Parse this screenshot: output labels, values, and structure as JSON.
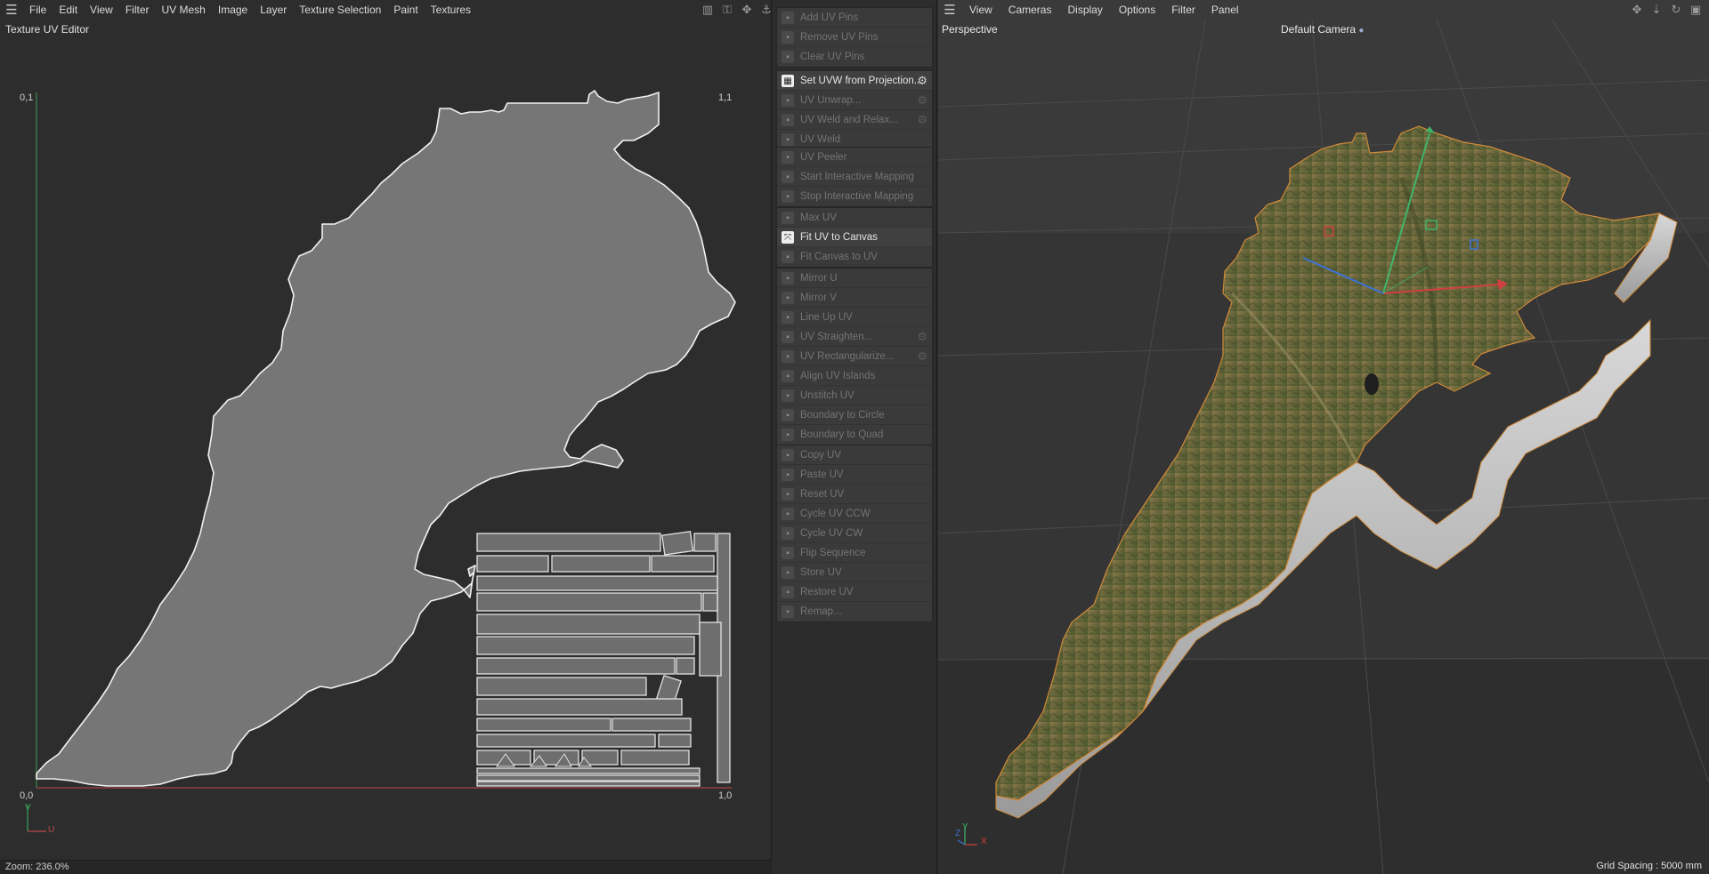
{
  "left_panel": {
    "menu": [
      "File",
      "Edit",
      "View",
      "Filter",
      "UV Mesh",
      "Image",
      "Layer",
      "Texture Selection",
      "Paint",
      "Textures"
    ],
    "title": "Texture UV Editor",
    "corner_labels": {
      "top_left": "0,1",
      "top_right": "1,1",
      "bottom_left": "0,0",
      "bottom_right": "1,0"
    },
    "axis_v": "V",
    "axis_u": "U",
    "zoom": "Zoom: 236.0%"
  },
  "commands": {
    "groups": [
      [
        {
          "label": "Add UV Pins",
          "enabled": false,
          "icon": "pin-add-icon",
          "gear": false
        },
        {
          "label": "Remove UV Pins",
          "enabled": false,
          "icon": "pin-remove-icon",
          "gear": false
        },
        {
          "label": "Clear UV Pins",
          "enabled": false,
          "icon": "pin-clear-icon",
          "gear": false
        }
      ],
      [
        {
          "label": "Set UVW from Projection...",
          "enabled": true,
          "icon": "checker-icon",
          "gear": true
        },
        {
          "label": "UV Unwrap...",
          "enabled": false,
          "icon": "unwrap-icon",
          "gear": true
        },
        {
          "label": "UV Weld and Relax...",
          "enabled": false,
          "icon": "weld-relax-icon",
          "gear": true
        },
        {
          "label": "UV Weld",
          "enabled": false,
          "icon": "weld-icon",
          "gear": false
        }
      ],
      [
        {
          "label": "UV Peeler",
          "enabled": false,
          "icon": "peeler-icon",
          "gear": false
        },
        {
          "label": "Start Interactive Mapping",
          "enabled": false,
          "icon": "interactive-start-icon",
          "gear": false
        },
        {
          "label": "Stop Interactive Mapping",
          "enabled": false,
          "icon": "interactive-stop-icon",
          "gear": false
        }
      ],
      [
        {
          "label": "Max UV",
          "enabled": false,
          "icon": "max-uv-icon",
          "gear": false
        },
        {
          "label": "Fit UV to Canvas",
          "enabled": true,
          "icon": "fit-uv-icon",
          "gear": false
        },
        {
          "label": "Fit Canvas to UV",
          "enabled": false,
          "icon": "fit-canvas-icon",
          "gear": false
        }
      ],
      [
        {
          "label": "Mirror U",
          "enabled": false,
          "icon": "mirror-u-icon",
          "gear": false
        },
        {
          "label": "Mirror V",
          "enabled": false,
          "icon": "mirror-v-icon",
          "gear": false
        },
        {
          "label": "Line Up UV",
          "enabled": false,
          "icon": "line-up-icon",
          "gear": false
        },
        {
          "label": "UV Straighten...",
          "enabled": false,
          "icon": "straighten-icon",
          "gear": true
        },
        {
          "label": "UV Rectangularize...",
          "enabled": false,
          "icon": "rectangularize-icon",
          "gear": true
        },
        {
          "label": "Align UV Islands",
          "enabled": false,
          "icon": "align-islands-icon",
          "gear": false
        },
        {
          "label": "Unstitch UV",
          "enabled": false,
          "icon": "unstitch-icon",
          "gear": false
        },
        {
          "label": "Boundary to Circle",
          "enabled": false,
          "icon": "boundary-circle-icon",
          "gear": false
        },
        {
          "label": "Boundary to Quad",
          "enabled": false,
          "icon": "boundary-quad-icon",
          "gear": false
        }
      ],
      [
        {
          "label": "Copy UV",
          "enabled": false,
          "icon": "copy-uv-icon",
          "gear": false
        },
        {
          "label": "Paste UV",
          "enabled": false,
          "icon": "paste-uv-icon",
          "gear": false
        },
        {
          "label": "Reset UV",
          "enabled": false,
          "icon": "reset-uv-icon",
          "gear": false
        },
        {
          "label": "Cycle UV CCW",
          "enabled": false,
          "icon": "cycle-ccw-icon",
          "gear": false
        },
        {
          "label": "Cycle UV CW",
          "enabled": false,
          "icon": "cycle-cw-icon",
          "gear": false
        },
        {
          "label": "Flip Sequence",
          "enabled": false,
          "icon": "flip-sequence-icon",
          "gear": false
        },
        {
          "label": "Store UV",
          "enabled": false,
          "icon": "store-uv-icon",
          "gear": false
        },
        {
          "label": "Restore UV",
          "enabled": false,
          "icon": "restore-uv-icon",
          "gear": false
        },
        {
          "label": "Remap...",
          "enabled": false,
          "icon": "remap-icon",
          "gear": false
        }
      ]
    ]
  },
  "viewport": {
    "menu": [
      "View",
      "Cameras",
      "Display",
      "Options",
      "Filter",
      "Panel"
    ],
    "title": "Perspective",
    "camera": "Default Camera",
    "grid_spacing": "Grid Spacing : 5000 mm",
    "axis_labels": {
      "x": "X",
      "y": "Y",
      "z": "Z"
    }
  },
  "colors": {
    "panel_bg": "#2d2d2d",
    "uv_fill": "#767676",
    "uv_outline": "#f2f2f2",
    "v_axis": "#3aa05a",
    "u_axis": "#c04848",
    "terrain_dark": "#4f5a30",
    "terrain_light": "#8d7a4c",
    "terrain_side": "#bcbcbc",
    "terrain_edge": "#d08a3a"
  }
}
